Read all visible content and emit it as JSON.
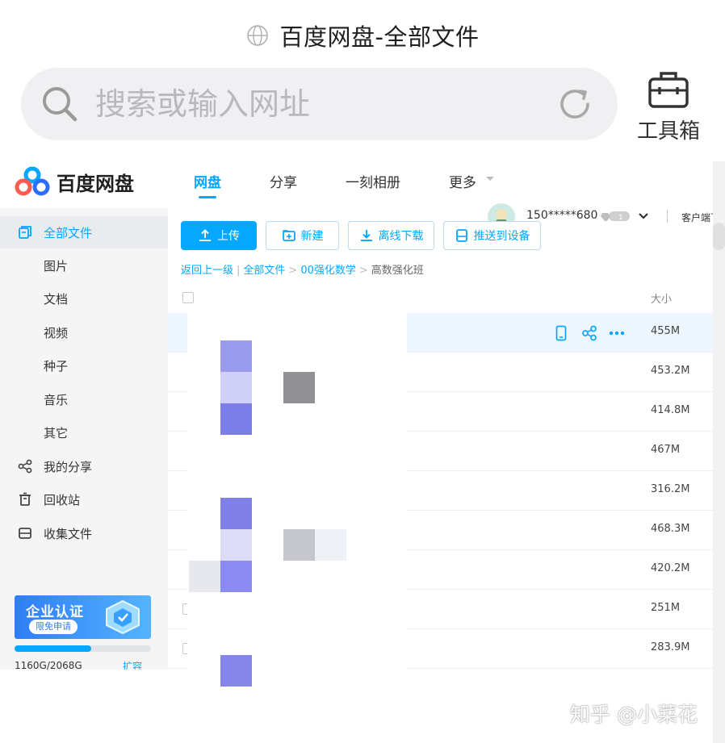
{
  "browser": {
    "page_title": "百度网盘-全部文件",
    "address_placeholder": "搜索或输入网址",
    "toolbox_label": "工具箱"
  },
  "app": {
    "logo_text": "百度网盘",
    "nav": [
      {
        "label": "网盘",
        "active": true
      },
      {
        "label": "分享"
      },
      {
        "label": "一刻相册"
      },
      {
        "label": "更多"
      }
    ],
    "user": {
      "name": "150*****680",
      "vip_badge": "1",
      "client_text": "客户端下载"
    },
    "sidebar": {
      "items": [
        {
          "label": "全部文件",
          "icon": "all-files-icon",
          "active": true
        },
        {
          "label": "图片"
        },
        {
          "label": "文档"
        },
        {
          "label": "视频"
        },
        {
          "label": "种子"
        },
        {
          "label": "音乐"
        },
        {
          "label": "其它"
        },
        {
          "label": "我的分享",
          "icon": "share-icon"
        },
        {
          "label": "回收站",
          "icon": "trash-icon"
        },
        {
          "label": "收集文件",
          "icon": "collect-icon"
        }
      ],
      "banner": {
        "title": "企业认证",
        "button": "限免申请"
      },
      "quota": {
        "text": "1160G/2068G",
        "used_fraction": 0.561,
        "expand_label": "扩容"
      }
    },
    "toolbar": {
      "upload": "上传",
      "new": "新建",
      "offline": "离线下载",
      "push": "推送到设备"
    },
    "breadcrumb": {
      "back": "返回上一级",
      "sep1": "|",
      "all": "全部文件",
      "sep2": ">",
      "folder": "00强化数学",
      "sep3": ">",
      "current": "高数强化班"
    },
    "table": {
      "size_header": "大小",
      "rows": [
        {
          "size": "455M"
        },
        {
          "size": "453.2M"
        },
        {
          "size": "414.8M"
        },
        {
          "size": "467M"
        },
        {
          "size": "316.2M"
        },
        {
          "size": "468.3M"
        },
        {
          "size": "420.2M"
        },
        {
          "size": "251M"
        },
        {
          "size": "283.9M"
        }
      ]
    }
  },
  "watermark": "知乎 @小菜花",
  "colors": {
    "accent": "#06a7ff",
    "sidebar_bg": "#f5f5f6",
    "highlight_row": "#eef6ff"
  }
}
